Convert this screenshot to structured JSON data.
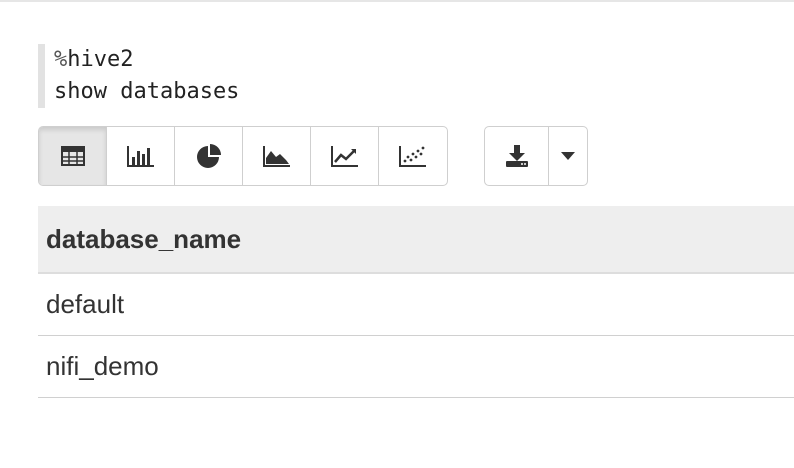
{
  "editor": {
    "lines": [
      {
        "prefix": "%",
        "text": "hive2"
      },
      {
        "prefix": "",
        "text": "show databases"
      }
    ]
  },
  "toolbar": {
    "visualizations": [
      {
        "icon": "table-icon",
        "active": true
      },
      {
        "icon": "bar-chart-icon",
        "active": false
      },
      {
        "icon": "pie-chart-icon",
        "active": false
      },
      {
        "icon": "area-chart-icon",
        "active": false
      },
      {
        "icon": "line-chart-icon",
        "active": false
      },
      {
        "icon": "scatter-chart-icon",
        "active": false
      }
    ],
    "download": {
      "icon": "download-icon"
    },
    "dropdown": {
      "icon": "caret-down-icon"
    }
  },
  "table": {
    "columns": [
      "database_name"
    ],
    "rows": [
      [
        "default"
      ],
      [
        "nifi_demo"
      ]
    ]
  },
  "colors": {
    "active_button_bg": "#e6e6e6",
    "header_bg": "#eeeeee",
    "icon": "#333333"
  }
}
